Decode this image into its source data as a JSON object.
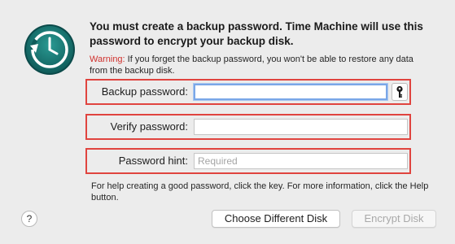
{
  "dialog": {
    "title": "You must create a backup password. Time Machine will use this password to encrypt your backup disk.",
    "warning_label": "Warning:",
    "warning_text": " If you forget the backup password, you won't be able to restore any data from the backup disk.",
    "app_icon": "time-machine-icon"
  },
  "fields": {
    "backup_password": {
      "label": "Backup password:",
      "value": ""
    },
    "verify_password": {
      "label": "Verify password:",
      "value": ""
    },
    "password_hint": {
      "label": "Password hint:",
      "value": "",
      "placeholder": "Required"
    }
  },
  "key_button": {
    "icon": "key-icon"
  },
  "help_text": "For help creating a good password, click the key. For more information, click the Help button.",
  "buttons": {
    "help": "?",
    "choose_disk": "Choose Different Disk",
    "encrypt_disk": "Encrypt Disk"
  },
  "colors": {
    "warning": "#d0312d",
    "highlight_border": "#e0443f",
    "focus_ring": "#7aa7e8",
    "icon_teal": "#1f7a7a"
  }
}
